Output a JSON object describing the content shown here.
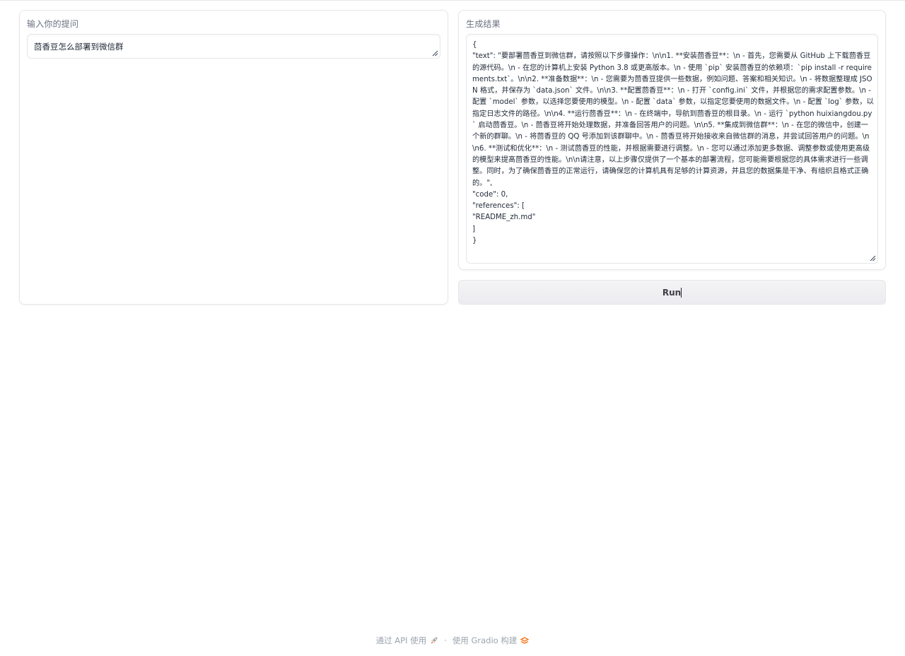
{
  "left_panel": {
    "label": "输入你的提问",
    "question_value": "茴香豆怎么部署到微信群"
  },
  "right_panel": {
    "label": "生成结果",
    "result_lines": [
      "{",
      "  \"text\": \"要部署茴香豆到微信群，请按照以下步骤操作：\\n\\n1. **安装茴香豆**：\\n   - 首先，您需要从 GitHub 上下载茴香豆的源代码。\\n   - 在您的计算机上安装 Python 3.8 或更高版本。\\n   - 使用 `pip` 安装茴香豆的依赖项：`pip install -r requirements.txt`。\\n\\n2. **准备数据**：\\n   - 您需要为茴香豆提供一些数据，例如问题、答案和相关知识。\\n   - 将数据整理成 JSON 格式，并保存为 `data.json` 文件。\\n\\n3. **配置茴香豆**：\\n   - 打开 `config.ini` 文件，并根据您的需求配置参数。\\n   - 配置 `model` 参数，以选择您要使用的模型。\\n   - 配置 `data` 参数，以指定您要使用的数据文件。\\n   - 配置 `log` 参数，以指定日志文件的路径。\\n\\n4. **运行茴香豆**：\\n   - 在终端中，导航到茴香豆的根目录。\\n   - 运行 `python huixiangdou.py` 启动茴香豆。\\n   - 茴香豆将开始处理数据，并准备回答用户的问题。\\n\\n5. **集成到微信群**：\\n   - 在您的微信中，创建一个新的群聊。\\n   - 将茴香豆的 QQ 号添加到该群聊中。\\n   - 茴香豆将开始接收来自微信群的消息，并尝试回答用户的问题。\\n\\n6. **测试和优化**：\\n   - 测试茴香豆的性能，并根据需要进行调整。\\n   - 您可以通过添加更多数据、调整参数或使用更高级的模型来提高茴香豆的性能。\\n\\n请注意，以上步骤仅提供了一个基本的部署流程，您可能需要根据您的具体需求进行一些调整。同时，为了确保茴香豆的正常运行，请确保您的计算机具有足够的计算资源，并且您的数据集是干净、有组织且格式正确的。\",",
      "  \"code\": 0,",
      "  \"references\": [",
      "    \"README_zh.md\"",
      "  ]",
      "}"
    ]
  },
  "run_button": {
    "label": "Run"
  },
  "footer": {
    "api_text": "通过 API 使用",
    "separator": "·",
    "gradio_text": "使用 Gradio 构建"
  },
  "icons": {
    "api": "rocket-icon",
    "gradio": "gradio-logo-icon"
  }
}
